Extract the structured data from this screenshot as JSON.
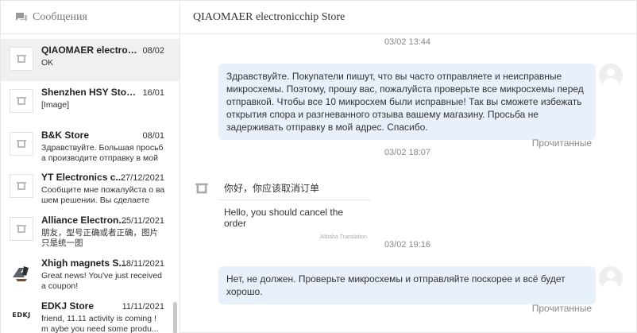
{
  "sidebar": {
    "title": "Сообщения",
    "conversations": [
      {
        "name": "QIAOMAER electronic...",
        "date": "08/02",
        "preview": "OK",
        "active": true,
        "avatar": "store-icon"
      },
      {
        "name": "Shenzhen HSY Store ...",
        "date": "16/01",
        "preview": "[Image]",
        "active": false,
        "avatar": "store-icon"
      },
      {
        "name": "B&K Store",
        "date": "08/01",
        "preview": "Здравствуйте. Большая просьб а производите отправку в мой а...",
        "active": false,
        "avatar": "store-icon"
      },
      {
        "name": "YT Electronics c...",
        "date": "27/12/2021",
        "preview": "Сообщите мне пожалуйста о ва шем решении. Вы сделаете по...",
        "active": false,
        "avatar": "store-icon"
      },
      {
        "name": "Alliance Electron...",
        "date": "25/11/2021",
        "preview": "朋友，型号正确或者正确，图片只是统一图",
        "active": false,
        "avatar": "store-icon"
      },
      {
        "name": "Xhigh magnets S...",
        "date": "18/11/2021",
        "preview": "Great news! You've just received a coupon!",
        "active": false,
        "avatar": "magnets-logo"
      },
      {
        "name": "EDKJ Store",
        "date": "11/11/2021",
        "preview": "friend, 11.11 activity is coming ! m aybe you need some produ...",
        "active": false,
        "avatar": "EDKJ"
      }
    ]
  },
  "main": {
    "title": "QIAOMAER electronicchip Store",
    "read_label": "Прочитанные",
    "translation_label": "Alibaba Translation",
    "messages": [
      {
        "timestamp": "03/02 13:44",
        "text": "Здравствуйте. Покупатели пишут, что вы часто отправляете и неисправные микросхемы. Поэтому, прошу вас, пожалуйста проверьте все микросхемы перед отправкой. Чтобы все 10 микросхем были исправные! Так вы сможете избежать открытия спора и разгневанного отзыва вашему магазину. Просьба не задерживать отправку в мой адрес. Спасибо."
      },
      {
        "timestamp": "03/02 18:07",
        "original": "你好，你应该取消订单",
        "translation": "Hello, you should cancel the order"
      },
      {
        "timestamp": "03/02 19:16",
        "text": "Нет, не должен. Проверьте микросхемы и отправляйте поскорее и всё будет хорошо."
      }
    ]
  },
  "colors": {
    "outgoing_bubble": "#e8f0fc",
    "active_conversation": "#f0f0f0",
    "scrollbar": "#c8c8c8"
  }
}
